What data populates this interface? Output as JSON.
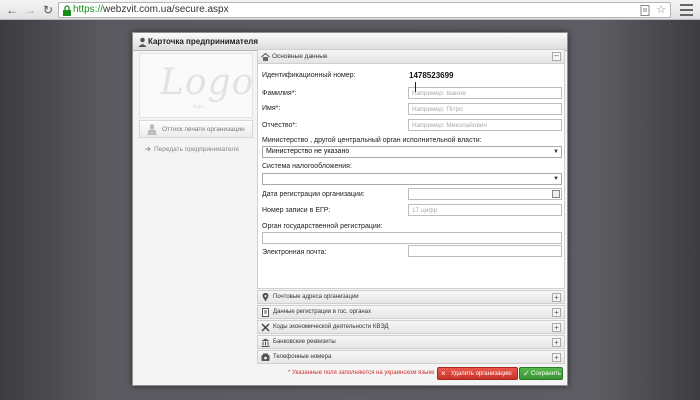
{
  "browser": {
    "url_scheme": "https://",
    "url_rest": "webzvit.com.ua/secure.aspx"
  },
  "dialog": {
    "title": "Карточка предпринимателя",
    "logo_text": "Logo",
    "logo_sub": "-logo-",
    "print_button": "Оттиск печати организации",
    "transfer_button": "Передать предпринимателя"
  },
  "main_section": {
    "title": "Основные данные",
    "id_label": "Идентификационный номер:",
    "id_value": "1478523699",
    "surname_label": "Фамилия*:",
    "surname_placeholder": "Например: Іванов",
    "name_label": "Имя*:",
    "name_placeholder": "Например: Пітро",
    "patronymic_label": "Отчество*:",
    "patronymic_placeholder": "Например: Миколайович",
    "ministry_label": "Министерство , другой центральный орган исполнительной власти:",
    "ministry_value": "Министерство не указано",
    "tax_label": "Система налогообложения:",
    "tax_value": "",
    "regdate_label": "Дата регистрации организации:",
    "egr_label": "Номер записи в ЕГР:",
    "egr_placeholder": "17 цифр",
    "reg_authority_label": "Орган государственной регистрации:",
    "email_label": "Электронная почта:"
  },
  "sections": [
    {
      "label": "Почтовые адреса организации",
      "icon": "map-pin-icon"
    },
    {
      "label": "Данные регистрации в гос. органах",
      "icon": "document-icon"
    },
    {
      "label": "Коды экономической деятельности КВЭД",
      "icon": "tools-icon"
    },
    {
      "label": "Банковские реквизиты",
      "icon": "bank-icon"
    },
    {
      "label": "Телефонные номера",
      "icon": "phone-icon"
    }
  ],
  "footer": {
    "required_note": "* Указанные поля заполняются на украинском языке",
    "delete_button": "Удалить организацию",
    "save_button": "Сохранить"
  },
  "colors": {
    "required_note": "#d03030",
    "delete_button": "#d9443a",
    "save_button": "#46a43e",
    "url_secure": "#1a8c1a"
  }
}
